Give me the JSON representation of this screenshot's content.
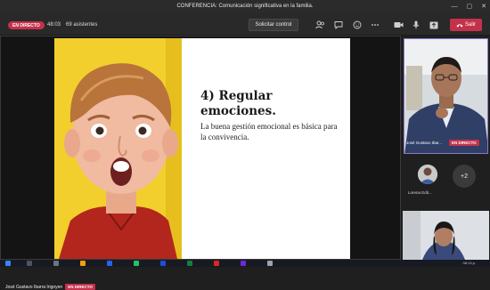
{
  "window": {
    "title": "CONFERENCIA: Comunicación significativa en la familia.",
    "minimize_glyph": "—",
    "maximize_glyph": "▢",
    "close_glyph": "✕"
  },
  "toolbar": {
    "live_badge": "EN DIRECTO",
    "timer": "48:03",
    "attendees": "69 asistentes",
    "request_control_label": "Solicitar control",
    "icons": [
      "people-icon",
      "chat-icon",
      "reactions-icon",
      "more-icon",
      "camera-icon",
      "mic-icon",
      "share-icon"
    ],
    "leave_label": "Salir",
    "leave_color": "#c4314b"
  },
  "slide": {
    "title": "4) Regular emociones.",
    "body": "La buena gestión emocional es básica para la convivencia."
  },
  "presenter": {
    "name": "José Gustavo Ibarra Irigoyen",
    "live_badge": "EN DIRECTO"
  },
  "participants": {
    "featured_name": "José Gustavo Ibar...",
    "featured_badge": "EN DIRECTO",
    "second_name": "Lorena Edit...",
    "more_count": "+2"
  },
  "taskbar": {
    "time": "08:13 p."
  }
}
